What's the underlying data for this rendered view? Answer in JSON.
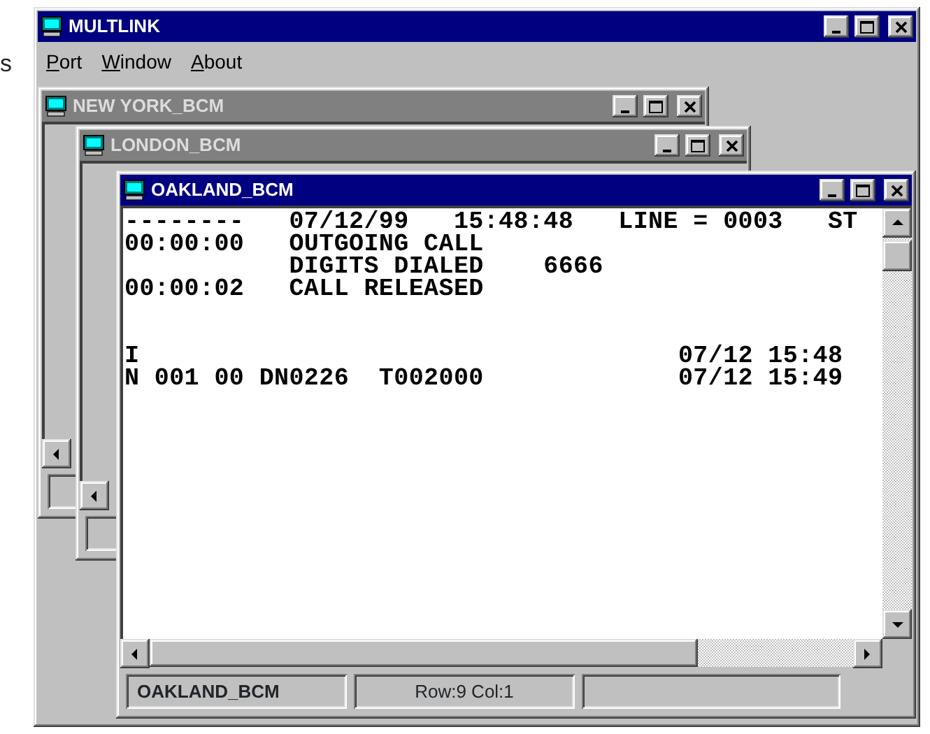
{
  "edge_text": "s",
  "window": {
    "title": "MULTLINK",
    "active": true
  },
  "menu": [
    {
      "label": "Port"
    },
    {
      "label": "Window"
    },
    {
      "label": "About"
    }
  ],
  "child_windows": [
    {
      "title": "NEW YORK_BCM",
      "active": false
    },
    {
      "title": "LONDON_BCM",
      "active": false
    },
    {
      "title": "OAKLAND_BCM",
      "active": true,
      "terminal_lines": [
        {
          "kind": "text",
          "text": "--------   07/12/99   15:48:48   LINE = 0003   ST"
        },
        {
          "kind": "text",
          "text": "00:00:00   OUTGOING CALL"
        },
        {
          "kind": "text",
          "text": "           DIGITS DIALED    6666"
        },
        {
          "kind": "text",
          "text": "00:00:02   CALL RELEASED"
        },
        {
          "kind": "blank"
        },
        {
          "kind": "blank"
        },
        {
          "kind": "text",
          "text": "I                                    07/12 15:48"
        },
        {
          "kind": "text",
          "text": "N 001 00 DN0226  T002000             07/12 15:49"
        }
      ],
      "status_bar": [
        {
          "text": "OAKLAND_BCM",
          "bold": true
        },
        {
          "text": "Row:9 Col:1",
          "bold": false
        }
      ]
    }
  ]
}
